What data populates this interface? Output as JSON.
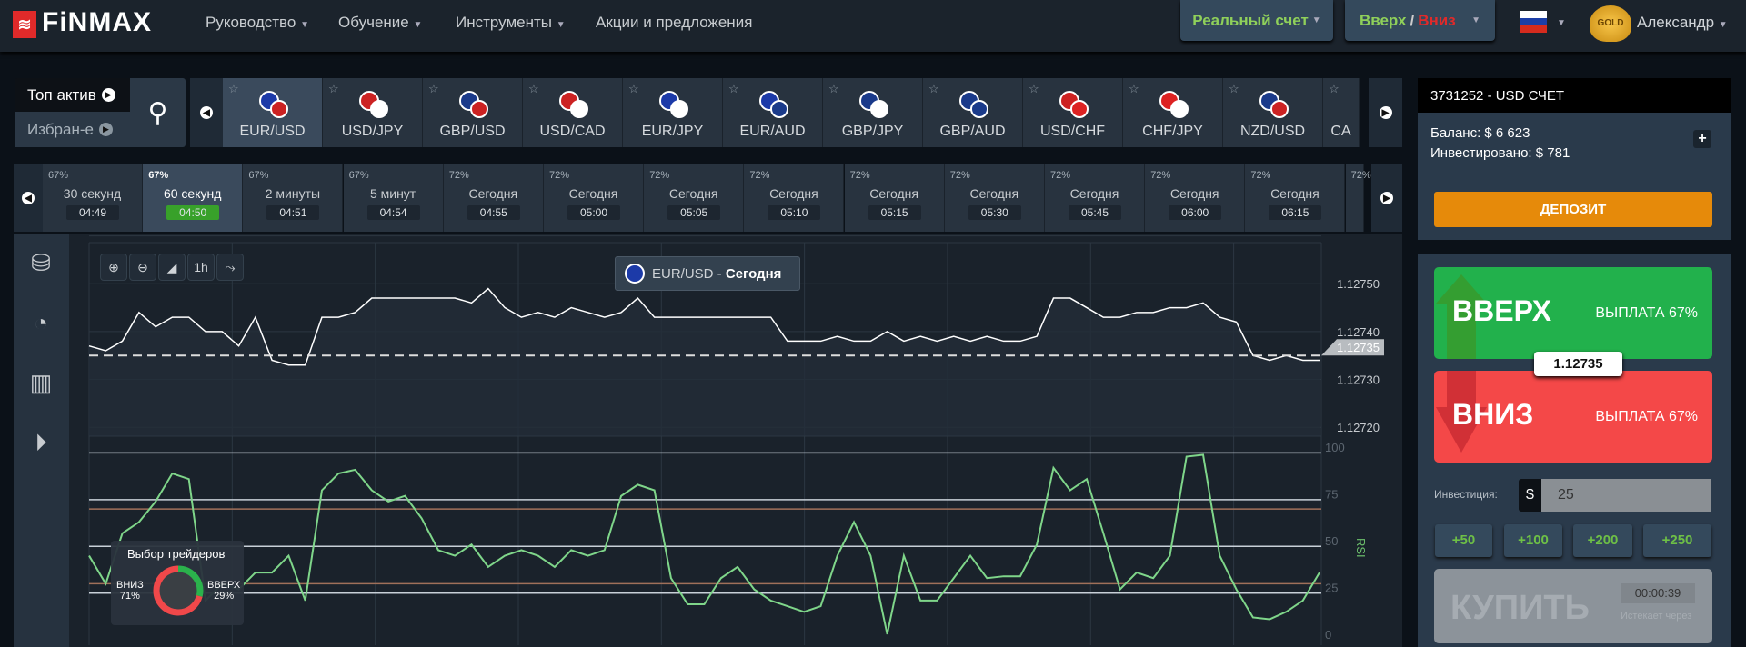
{
  "header": {
    "logo": "FiNMAX",
    "nav": [
      {
        "label": "Руководство",
        "dropdown": true
      },
      {
        "label": "Обучение",
        "dropdown": true
      },
      {
        "label": "Инструменты",
        "dropdown": true
      },
      {
        "label": "Акции и предложения",
        "dropdown": false
      }
    ],
    "account_mode": "Реальный счет",
    "mode_up": "Вверх",
    "mode_sep": " / ",
    "mode_down": "Вниз",
    "language_flag": "russia-flag-icon",
    "badge": "GOLD",
    "user": "Александр"
  },
  "assets_bar": {
    "top_label": "Топ актив",
    "fav_label": "Избран-е",
    "items": [
      "EUR/USD",
      "USD/JPY",
      "GBP/USD",
      "USD/CAD",
      "EUR/JPY",
      "EUR/AUD",
      "GBP/JPY",
      "GBP/AUD",
      "USD/CHF",
      "CHF/JPY",
      "NZD/USD",
      "CA"
    ],
    "selected": "EUR/USD"
  },
  "expiry_bar": {
    "items": [
      {
        "pct": "67%",
        "name": "30 секунд",
        "time": "04:49"
      },
      {
        "pct": "67%",
        "name": "60 секунд",
        "time": "04:50",
        "selected": true
      },
      {
        "pct": "67%",
        "name": "2 минуты",
        "time": "04:51"
      },
      {
        "pct": "67%",
        "name": "5 минут",
        "time": "04:54"
      },
      {
        "pct": "72%",
        "name": "Сегодня",
        "time": "04:55"
      },
      {
        "pct": "72%",
        "name": "Сегодня",
        "time": "05:00"
      },
      {
        "pct": "72%",
        "name": "Сегодня",
        "time": "05:05"
      },
      {
        "pct": "72%",
        "name": "Сегодня",
        "time": "05:10"
      },
      {
        "pct": "72%",
        "name": "Сегодня",
        "time": "05:15"
      },
      {
        "pct": "72%",
        "name": "Сегодня",
        "time": "05:30"
      },
      {
        "pct": "72%",
        "name": "Сегодня",
        "time": "05:45"
      },
      {
        "pct": "72%",
        "name": "Сегодня",
        "time": "06:00"
      },
      {
        "pct": "72%",
        "name": "Сегодня",
        "time": "06:15"
      },
      {
        "pct": "72%",
        "name": "",
        "time": ""
      }
    ]
  },
  "chart": {
    "tools": [
      "zoom-in",
      "zoom-out",
      "chart-type",
      "1h",
      "indicators"
    ],
    "timeframe": "1h",
    "title_asset": "EUR/USD",
    "title_sep": " - ",
    "title_period": "Сегодня"
  },
  "chart_data": [
    {
      "type": "line",
      "series_kind": "price",
      "ylim": [
        1.12715,
        1.12752
      ],
      "yticks": [
        "1.12750",
        "1.12740",
        "1.12730",
        "1.12720"
      ],
      "current": "1.12735",
      "current_value": 1.12735,
      "values": [
        1.12737,
        1.12736,
        1.12738,
        1.12744,
        1.12741,
        1.12743,
        1.12743,
        1.1274,
        1.1274,
        1.12737,
        1.12743,
        1.12734,
        1.12733,
        1.12733,
        1.12743,
        1.12743,
        1.12744,
        1.12747,
        1.12747,
        1.12747,
        1.12747,
        1.12747,
        1.12747,
        1.12746,
        1.12749,
        1.12745,
        1.12743,
        1.12744,
        1.12743,
        1.12745,
        1.12744,
        1.12743,
        1.12744,
        1.12747,
        1.12743,
        1.12743,
        1.12743,
        1.12743,
        1.12743,
        1.12743,
        1.12743,
        1.12743,
        1.12738,
        1.12738,
        1.12738,
        1.12739,
        1.12738,
        1.12738,
        1.1274,
        1.12738,
        1.12739,
        1.12738,
        1.12739,
        1.12738,
        1.12739,
        1.12738,
        1.12738,
        1.12739,
        1.12747,
        1.12747,
        1.12745,
        1.12743,
        1.12743,
        1.12744,
        1.12744,
        1.12745,
        1.12745,
        1.12746,
        1.12743,
        1.12742,
        1.12735,
        1.12734,
        1.12735,
        1.12734,
        1.12734
      ],
      "line_color": "#ffffff"
    },
    {
      "type": "line",
      "series_kind": "RSI",
      "ylabel": "RSI",
      "ylim": [
        0,
        100
      ],
      "yticks": [
        "100",
        "75",
        "50",
        "25",
        "0"
      ],
      "levels_white": [
        97,
        72,
        47,
        22
      ],
      "levels_brown": [
        67,
        27
      ],
      "values": [
        42,
        27,
        54,
        60,
        71,
        86,
        83,
        18,
        27,
        24,
        33,
        33,
        42,
        18,
        77,
        86,
        88,
        77,
        71,
        74,
        62,
        45,
        42,
        48,
        36,
        42,
        45,
        42,
        36,
        45,
        42,
        45,
        74,
        80,
        77,
        30,
        16,
        16,
        30,
        36,
        24,
        18,
        15,
        12,
        15,
        42,
        60,
        42,
        0,
        42,
        18,
        18,
        30,
        42,
        30,
        31,
        31,
        48,
        89,
        77,
        83,
        54,
        24,
        33,
        30,
        42,
        95,
        96,
        42,
        24,
        9,
        8,
        12,
        18,
        33
      ],
      "line_color": "#7fd68a"
    }
  ],
  "traders_choice": {
    "title": "Выбор трейдеров",
    "down_label": "ВНИЗ",
    "down_pct": "71%",
    "up_label": "ВВЕРХ",
    "up_pct": "29%",
    "down_value": 71,
    "up_value": 29,
    "down_color": "#f0484a",
    "up_color": "#2bb24c"
  },
  "account": {
    "title": "3731252 - USD СЧЕТ",
    "balance_label": "Баланс:",
    "balance": "$ 6 623",
    "invested_label": "Инвестировано:",
    "invested": "$ 781",
    "deposit": "ДЕПОЗИТ"
  },
  "trade": {
    "up_label": "ВВЕРХ",
    "up_payout": "ВЫПЛАТА 67%",
    "down_label": "ВНИЗ",
    "down_payout": "ВЫПЛАТА 67%",
    "price": "1.12735",
    "investment_label": "Инвестиция:",
    "currency": "$",
    "amount": "25",
    "quick": [
      "+50",
      "+100",
      "+200",
      "+250"
    ],
    "buy": "КУПИТЬ",
    "timer": "00:00:39",
    "expires_label": "Истекает через",
    "up_color": "#22b14c",
    "down_color": "#f44848",
    "deposit_color": "#e68a0a"
  }
}
